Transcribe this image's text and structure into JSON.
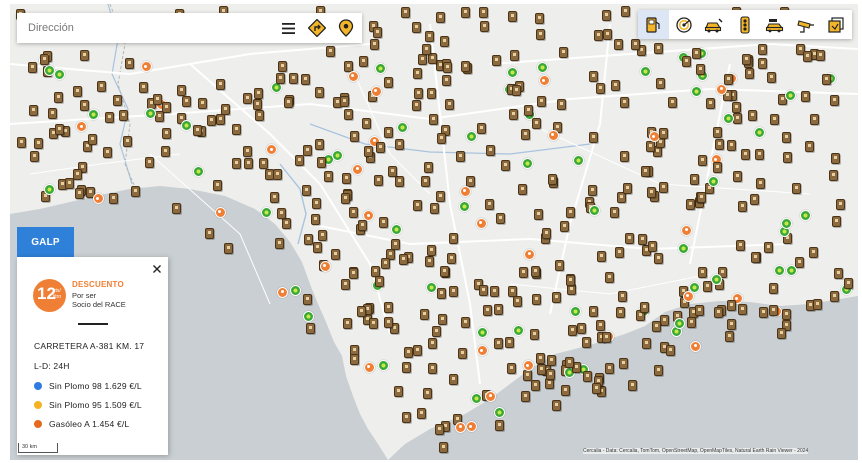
{
  "search": {
    "placeholder": "Dirección"
  },
  "search_actions": [
    {
      "name": "menu-icon"
    },
    {
      "name": "route-icon"
    },
    {
      "name": "location-pin-icon"
    }
  ],
  "toolbar": {
    "items": [
      {
        "name": "fuel-station-icon",
        "active": true
      },
      {
        "name": "radar-icon",
        "active": false
      },
      {
        "name": "car-service-icon",
        "active": false
      },
      {
        "name": "traffic-light-icon",
        "active": false
      },
      {
        "name": "weather-icon",
        "active": false
      },
      {
        "name": "camera-icon",
        "active": false
      },
      {
        "name": "layers-icon",
        "active": false
      }
    ]
  },
  "panel": {
    "tab_label": "GALP",
    "promo": {
      "amount": "12",
      "unit": "cts/\nlitro",
      "title": "DESCUENTO",
      "line1": "Por ser",
      "line2": "Socio del RACE"
    },
    "address": "CARRETERA A-381 KM. 17",
    "hours": "L-D: 24H",
    "fuels": [
      {
        "label": "Sin Plomo 98 1.629 €/L",
        "color": "#2f7ce0"
      },
      {
        "label": "Sin Plomo 95 1.509 €/L",
        "color": "#f5b324"
      },
      {
        "label": "Gasóleo A 1.454 €/L",
        "color": "#e46a1d"
      }
    ]
  },
  "map": {
    "scale_label": "30 km",
    "attribution": "Cercalia - Data: Cercalia, TomTom, OpenStreetMap, OpenMapTiles, Natural Earth Rain Viewer - 2024",
    "colors": {
      "sea": "#c9cfd2",
      "land": "#eeeeec",
      "roads": "#ffffff",
      "rivers": "#a9c3de",
      "border": "#b5b5b5"
    }
  }
}
